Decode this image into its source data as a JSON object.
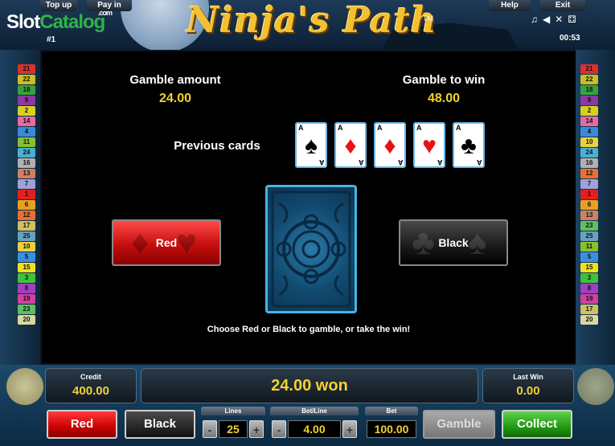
{
  "header": {
    "top_up": "Top up",
    "pay_in": "Pay in",
    "help": "Help",
    "exit": "Exit",
    "game_title": "Ninja's Path",
    "trademark": "TM",
    "logo_a": "Slot",
    "logo_b": "Catalog",
    "logo_com": ".com",
    "index": "#1",
    "timer": "00:53",
    "icons": [
      "music-icon",
      "volume-icon",
      "fullscreen-icon",
      "dice-icon"
    ]
  },
  "left_lines": [
    {
      "n": "21",
      "c": "#d83030"
    },
    {
      "n": "22",
      "c": "#c8c020"
    },
    {
      "n": "18",
      "c": "#3aa040"
    },
    {
      "n": "9",
      "c": "#8a3aa0"
    },
    {
      "n": "2",
      "c": "#d8d020"
    },
    {
      "n": "14",
      "c": "#e86aa0"
    },
    {
      "n": "4",
      "c": "#3a8ad8"
    },
    {
      "n": "11",
      "c": "#8ac030"
    },
    {
      "n": "24",
      "c": "#4ab0d0"
    },
    {
      "n": "16",
      "c": "#b0b0b0"
    },
    {
      "n": "13",
      "c": "#d08060"
    },
    {
      "n": "7",
      "c": "#a0a0d8"
    },
    {
      "n": "1",
      "c": "#e02020"
    },
    {
      "n": "6",
      "c": "#e8a020"
    },
    {
      "n": "12",
      "c": "#e87030"
    },
    {
      "n": "17",
      "c": "#d0c060"
    },
    {
      "n": "25",
      "c": "#6aa0c0"
    },
    {
      "n": "10",
      "c": "#e8d040"
    },
    {
      "n": "5",
      "c": "#3a90e0"
    },
    {
      "n": "15",
      "c": "#f0e020"
    },
    {
      "n": "3",
      "c": "#40c040"
    },
    {
      "n": "8",
      "c": "#a040c0"
    },
    {
      "n": "19",
      "c": "#d040a0"
    },
    {
      "n": "23",
      "c": "#60c060"
    },
    {
      "n": "20",
      "c": "#d8d8a0"
    }
  ],
  "right_lines": [
    {
      "n": "21",
      "c": "#d83030"
    },
    {
      "n": "22",
      "c": "#c8c020"
    },
    {
      "n": "18",
      "c": "#3aa040"
    },
    {
      "n": "9",
      "c": "#8a3aa0"
    },
    {
      "n": "2",
      "c": "#d8d020"
    },
    {
      "n": "14",
      "c": "#e86aa0"
    },
    {
      "n": "4",
      "c": "#3a8ad8"
    },
    {
      "n": "10",
      "c": "#e8d040"
    },
    {
      "n": "24",
      "c": "#4ab0d0"
    },
    {
      "n": "16",
      "c": "#b0b0b0"
    },
    {
      "n": "12",
      "c": "#e87030"
    },
    {
      "n": "7",
      "c": "#a0a0d8"
    },
    {
      "n": "1",
      "c": "#e02020"
    },
    {
      "n": "6",
      "c": "#e8a020"
    },
    {
      "n": "13",
      "c": "#d08060"
    },
    {
      "n": "23",
      "c": "#60c060"
    },
    {
      "n": "25",
      "c": "#6aa0c0"
    },
    {
      "n": "11",
      "c": "#8ac030"
    },
    {
      "n": "5",
      "c": "#3a90e0"
    },
    {
      "n": "15",
      "c": "#f0e020"
    },
    {
      "n": "3",
      "c": "#40c040"
    },
    {
      "n": "8",
      "c": "#a040c0"
    },
    {
      "n": "19",
      "c": "#d040a0"
    },
    {
      "n": "17",
      "c": "#d0c060"
    },
    {
      "n": "20",
      "c": "#d8d8a0"
    }
  ],
  "gamble": {
    "amount_label": "Gamble amount",
    "amount_value": "24.00",
    "to_win_label": "Gamble to win",
    "to_win_value": "48.00",
    "previous_label": "Previous cards",
    "previous_cards": [
      {
        "rank": "A",
        "suit": "♠",
        "color": "black",
        "name": "ace-of-spades"
      },
      {
        "rank": "A",
        "suit": "♦",
        "color": "red",
        "name": "ace-of-diamonds"
      },
      {
        "rank": "A",
        "suit": "♦",
        "color": "red",
        "name": "ace-of-diamonds"
      },
      {
        "rank": "A",
        "suit": "♥",
        "color": "red",
        "name": "ace-of-hearts"
      },
      {
        "rank": "A",
        "suit": "♣",
        "color": "black",
        "name": "ace-of-clubs"
      }
    ],
    "red_label": "Red",
    "black_label": "Black",
    "instruction": "Choose Red or Black to gamble, or take the win!"
  },
  "status": {
    "credit_label": "Credit",
    "credit_value": "400.00",
    "won_text": "24.00 won",
    "last_win_label": "Last Win",
    "last_win_value": "0.00"
  },
  "controls": {
    "red": "Red",
    "black": "Black",
    "lines_label": "Lines",
    "lines_value": "25",
    "bet_line_label": "Bet/Line",
    "bet_line_value": "4.00",
    "bet_label": "Bet",
    "bet_value": "100.00",
    "gamble": "Gamble",
    "collect": "Collect",
    "minus": "-",
    "plus": "+"
  }
}
